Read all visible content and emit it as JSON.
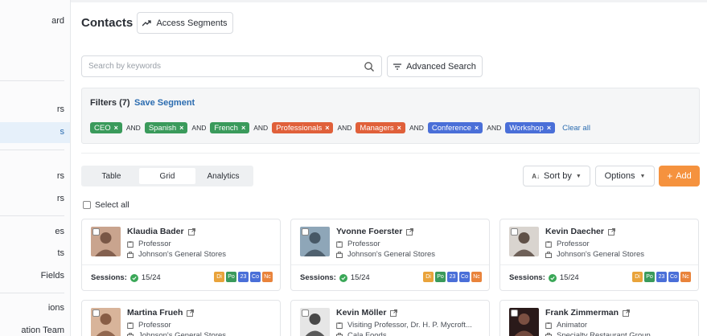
{
  "sidebar": {
    "items": [
      {
        "label": "ard",
        "active": false
      },
      {
        "label": "rs",
        "active": false
      },
      {
        "label": "s",
        "active": true
      },
      {
        "label": "rs",
        "active": false
      },
      {
        "label": "rs",
        "active": false
      },
      {
        "label": "es",
        "active": false
      },
      {
        "label": "ts",
        "active": false
      },
      {
        "label": "Fields",
        "active": false
      },
      {
        "label": "ions",
        "active": false
      },
      {
        "label": "ation Team",
        "active": false
      }
    ]
  },
  "header": {
    "title": "Contacts",
    "access_segments_label": "Access Segments"
  },
  "search": {
    "placeholder": "Search by keywords",
    "value": "",
    "advanced_label": "Advanced Search"
  },
  "filters": {
    "label": "Filters (7)",
    "save_segment_label": "Save Segment",
    "join_word": "AND",
    "clear_all_label": "Clear all",
    "chips": [
      {
        "label": "CEO",
        "color": "#3a9a5b"
      },
      {
        "label": "Spanish",
        "color": "#3a9a5b"
      },
      {
        "label": "French",
        "color": "#3a9a5b"
      },
      {
        "label": "Professionals",
        "color": "#e0603a"
      },
      {
        "label": "Managers",
        "color": "#e0603a"
      },
      {
        "label": "Conference",
        "color": "#4a6fd8"
      },
      {
        "label": "Workshop",
        "color": "#4a6fd8"
      }
    ]
  },
  "view_tabs": [
    {
      "label": "Table",
      "active": false
    },
    {
      "label": "Grid",
      "active": true
    },
    {
      "label": "Analytics",
      "active": false
    }
  ],
  "toolbar": {
    "sort_label": "Sort by",
    "options_label": "Options",
    "add_label": "Add"
  },
  "select_all_label": "Select all",
  "session_label": "Sessions:",
  "badge_colors": {
    "Di": "#e9a33b",
    "Po": "#3a9a5b",
    "23": "#4a6fd8",
    "Co": "#4a6fd8",
    "Nc": "#e9833b"
  },
  "cards": [
    {
      "name": "Klaudia Bader",
      "title": "Professor",
      "company": "Johnson's General Stores",
      "sessions": "15/24",
      "badges": [
        "Di",
        "Po",
        "23",
        "Co",
        "Nc"
      ],
      "avatar_bg": "#c9a48e",
      "avatar_fg": "#6b4a3a"
    },
    {
      "name": "Yvonne Foerster",
      "title": "Professor",
      "company": "Johnson's General Stores",
      "sessions": "15/24",
      "badges": [
        "Di",
        "Po",
        "23",
        "Co",
        "Nc"
      ],
      "avatar_bg": "#8ea6b8",
      "avatar_fg": "#3b4a57"
    },
    {
      "name": "Kevin Daecher",
      "title": "Professor",
      "company": "Johnson's General Stores",
      "sessions": "15/24",
      "badges": [
        "Di",
        "Po",
        "23",
        "Co",
        "Nc"
      ],
      "avatar_bg": "#d9d4cf",
      "avatar_fg": "#4a3a30"
    },
    {
      "name": "Martina Frueh",
      "title": "Professor",
      "company": "Johnson's General Stores",
      "sessions": "",
      "badges": [],
      "avatar_bg": "#d8b49a",
      "avatar_fg": "#7a4e36"
    },
    {
      "name": "Kevin Möller",
      "title": "Visiting Professor, Dr. H. P. Mycroft...",
      "company": "Cala Foods",
      "sessions": "",
      "badges": [],
      "avatar_bg": "#e6e6e6",
      "avatar_fg": "#2b2b2b"
    },
    {
      "name": "Frank Zimmerman",
      "title": "Animator",
      "company": "Specialty Restaurant Group",
      "sessions": "",
      "badges": [],
      "avatar_bg": "#2a1a1a",
      "avatar_fg": "#8a5a4a"
    }
  ]
}
